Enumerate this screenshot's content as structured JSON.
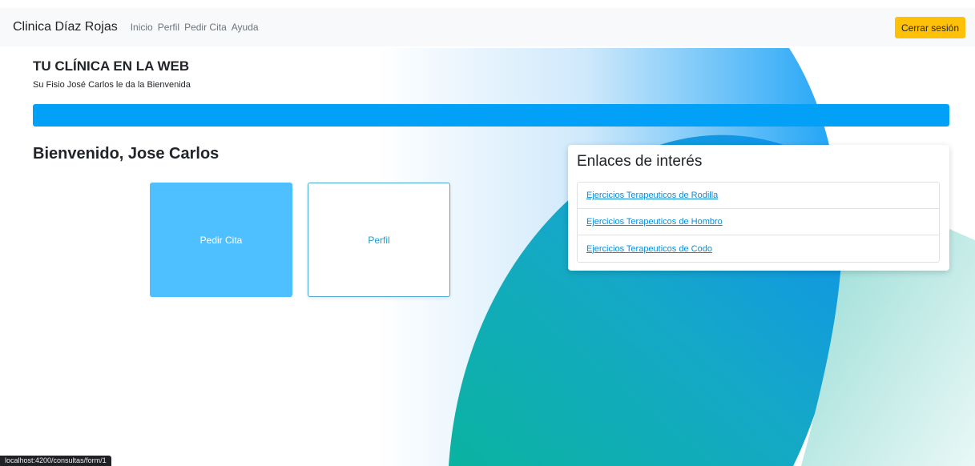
{
  "navbar": {
    "brand": "Clinica Díaz Rojas",
    "links": [
      "Inicio",
      "Perfil",
      "Pedir Cita",
      "Ayuda"
    ],
    "logout_label": "Cerrar sesión",
    "logout_color": "#ffc107"
  },
  "header": {
    "title": "TU CLÍNICA EN LA WEB",
    "subtitle": "Su Fisio José Carlos le da la Bienvenida",
    "bar_color": "#03a0f7"
  },
  "main": {
    "welcome": "Bienvenido, Jose Carlos",
    "buttons": {
      "pedir_cita": "Pedir Cita",
      "perfil": "Perfil"
    }
  },
  "links_card": {
    "title": "Enlaces de interés",
    "items": [
      "Ejercicios Terapeuticos de Rodilla",
      "Ejercicios Terapeuticos de Hombro",
      "Ejercicios Terapeuticos de Codo"
    ]
  },
  "status_bar": {
    "url": "localhost:4200/consultas/form/1"
  }
}
